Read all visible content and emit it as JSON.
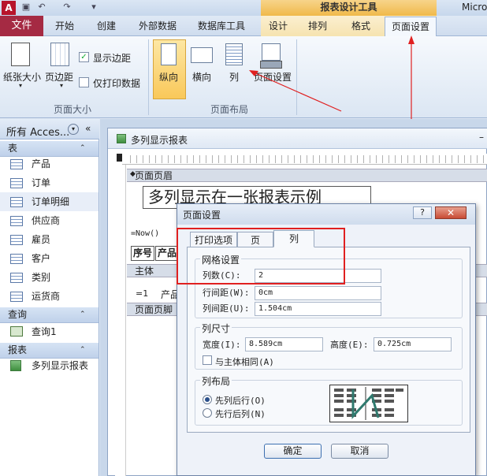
{
  "window": {
    "app_logo": "A",
    "contextual_group": "报表设计工具",
    "app_title": "Micro"
  },
  "tabs": {
    "file": "文件",
    "items": [
      "开始",
      "创建",
      "外部数据",
      "数据库工具",
      "设计",
      "排列",
      "格式",
      "页面设置"
    ],
    "active": "页面设置"
  },
  "ribbon": {
    "paper_size": "纸张大小",
    "margins": "页边距",
    "show_margins": "显示边距",
    "print_data_only": "仅打印数据",
    "group_page_size": "页面大小",
    "portrait": "纵向",
    "landscape": "横向",
    "columns": "列",
    "page_setup": "页面设置",
    "group_page_layout": "页面布局"
  },
  "nav": {
    "header": "所有 Acces...",
    "sections": [
      {
        "title": "表",
        "items": [
          "产品",
          "订单",
          "订单明细",
          "供应商",
          "雇员",
          "客户",
          "类别",
          "运货商"
        ]
      },
      {
        "title": "查询",
        "items": [
          "查询1"
        ]
      },
      {
        "title": "报表",
        "items": [
          "多列显示报表"
        ]
      }
    ],
    "selected": "订单明细"
  },
  "report": {
    "tab_title": "多列显示报表",
    "page_header_band": "页面页眉",
    "report_title": "多列显示在一张报表示例",
    "now_expr": "=Now()",
    "col_seq": "序号",
    "col_product": "产品",
    "detail_band": "主体",
    "detail_seq": "=1",
    "detail_product": "产品",
    "page_footer_band": "页面页脚"
  },
  "dialog": {
    "title": "页面设置",
    "help": "?",
    "close": "✕",
    "tabs": [
      "打印选项",
      "页",
      "列"
    ],
    "active_tab": "列",
    "grid_settings": "网格设置",
    "num_columns_label": "列数(C):",
    "num_columns_value": "2",
    "row_spacing_label": "行间距(W):",
    "row_spacing_value": "0cm",
    "column_spacing_label": "列间距(U):",
    "column_spacing_value": "1.504cm",
    "column_size": "列尺寸",
    "width_label": "宽度(I):",
    "width_value": "8.589cm",
    "height_label": "高度(E):",
    "height_value": "0.725cm",
    "same_as_detail": "与主体相同(A)",
    "column_layout": "列布局",
    "down_then_across": "先列后行(O)",
    "across_then_down": "先行后列(N)",
    "ok": "确定",
    "cancel": "取消"
  }
}
